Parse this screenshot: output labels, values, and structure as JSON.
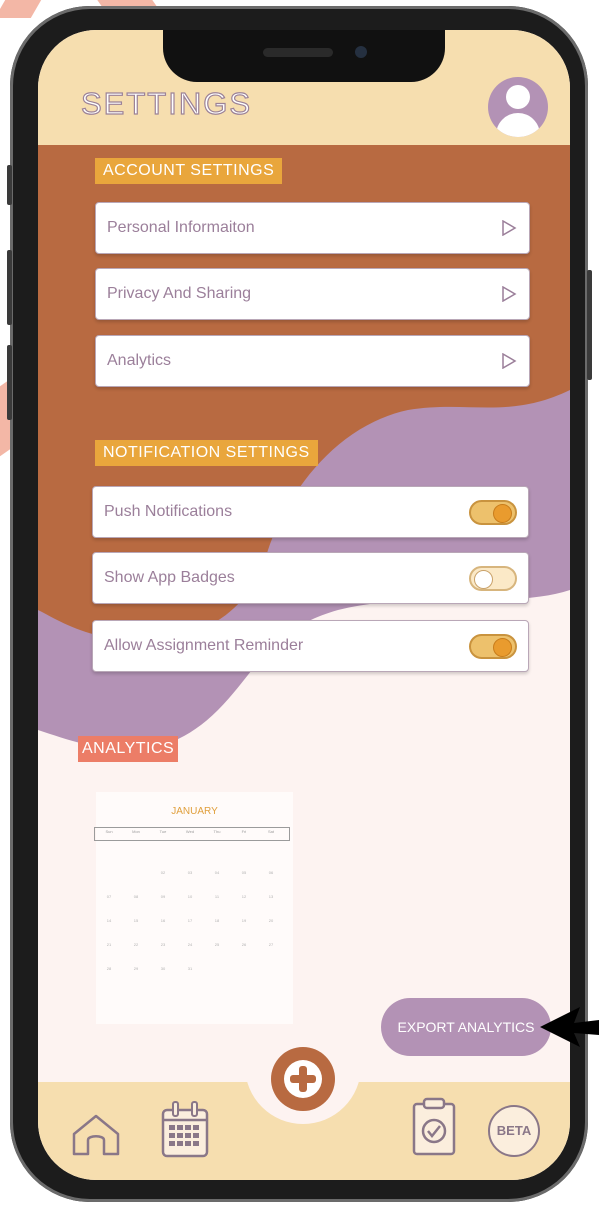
{
  "header": {
    "title": "SETTINGS"
  },
  "account_settings": {
    "label": "ACCOUNT SETTINGS",
    "items": [
      {
        "label": "Personal Informaiton",
        "icon": "chevron-right-icon"
      },
      {
        "label": "Privacy And Sharing",
        "icon": "chevron-right-icon"
      },
      {
        "label": "Analytics",
        "icon": "chevron-right-icon"
      }
    ]
  },
  "notification_settings": {
    "label": "NOTIFICATION SETTINGS",
    "items": [
      {
        "label": "Push Notifications",
        "enabled": true
      },
      {
        "label": "Show App Badges",
        "enabled": false
      },
      {
        "label": "Allow Assignment Reminder",
        "enabled": true
      }
    ]
  },
  "analytics": {
    "label": "ANALYTICS",
    "calendar": {
      "month": "JANUARY",
      "weekdays": [
        "Sun",
        "Mon",
        "Tue",
        "Wed",
        "Thu",
        "Fri",
        "Sat"
      ],
      "weeks": [
        [
          "",
          "",
          "02",
          "03",
          "04",
          "05",
          "06"
        ],
        [
          "07",
          "08",
          "09",
          "10",
          "11",
          "12",
          "13"
        ],
        [
          "14",
          "15",
          "16",
          "17",
          "18",
          "19",
          "20"
        ],
        [
          "21",
          "22",
          "23",
          "24",
          "25",
          "26",
          "27"
        ],
        [
          "28",
          "29",
          "30",
          "31",
          "",
          "",
          ""
        ]
      ]
    },
    "export_label": "EXPORT ANALYTICS"
  },
  "footer": {
    "home_icon": "home-icon",
    "calendar_icon": "calendar-icon",
    "add_icon": "plus-icon",
    "checklist_icon": "clipboard-check-icon",
    "beta_label": "BETA"
  },
  "colors": {
    "header": "#f6deaf",
    "rust": "#b86a41",
    "lavender": "#b392b5",
    "section_orange": "#e9a63c",
    "analytics_coral": "#ec7d67",
    "toggle_on": "#edc16c",
    "text": "#9b7f9a"
  }
}
